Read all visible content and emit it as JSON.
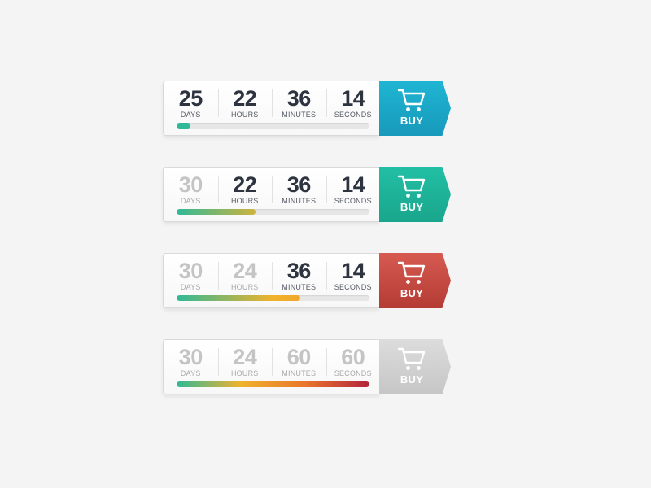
{
  "timers": [
    {
      "units": [
        {
          "value": "25",
          "label": "DAYS",
          "done": false
        },
        {
          "value": "22",
          "label": "HOURS",
          "done": false
        },
        {
          "value": "36",
          "label": "MINUTES",
          "done": false
        },
        {
          "value": "14",
          "label": "SECONDS",
          "done": false
        }
      ],
      "progress": 0.07,
      "button_label": "BUY",
      "button_colors": [
        "#1fb6d3",
        "#1799bb"
      ],
      "fill_colors": [
        "#2fb996",
        "#2fb996"
      ]
    },
    {
      "units": [
        {
          "value": "30",
          "label": "DAYS",
          "done": true
        },
        {
          "value": "22",
          "label": "HOURS",
          "done": false
        },
        {
          "value": "36",
          "label": "MINUTES",
          "done": false
        },
        {
          "value": "14",
          "label": "SECONDS",
          "done": false
        }
      ],
      "progress": 0.41,
      "button_label": "BUY",
      "button_colors": [
        "#22bfa5",
        "#19a68c"
      ],
      "fill_colors": [
        "#2fb996",
        "#f0b22c",
        "#f29a2b"
      ]
    },
    {
      "units": [
        {
          "value": "30",
          "label": "DAYS",
          "done": true
        },
        {
          "value": "24",
          "label": "HOURS",
          "done": true
        },
        {
          "value": "36",
          "label": "MINUTES",
          "done": false
        },
        {
          "value": "14",
          "label": "SECONDS",
          "done": false
        }
      ],
      "progress": 0.64,
      "button_label": "BUY",
      "button_colors": [
        "#d65a50",
        "#b43c35"
      ],
      "fill_colors": [
        "#2fb996",
        "#f0b22c",
        "#f08a2b"
      ]
    },
    {
      "units": [
        {
          "value": "30",
          "label": "DAYS",
          "done": true
        },
        {
          "value": "24",
          "label": "HOURS",
          "done": true
        },
        {
          "value": "60",
          "label": "MINUTES",
          "done": true
        },
        {
          "value": "60",
          "label": "SECONDS",
          "done": true
        }
      ],
      "progress": 1.0,
      "button_label": "BUY",
      "button_colors": [
        "#dcdcdc",
        "#c6c6c6"
      ],
      "fill_colors": [
        "#2fb996",
        "#f0b22c",
        "#e9762b",
        "#b3223d"
      ]
    }
  ]
}
